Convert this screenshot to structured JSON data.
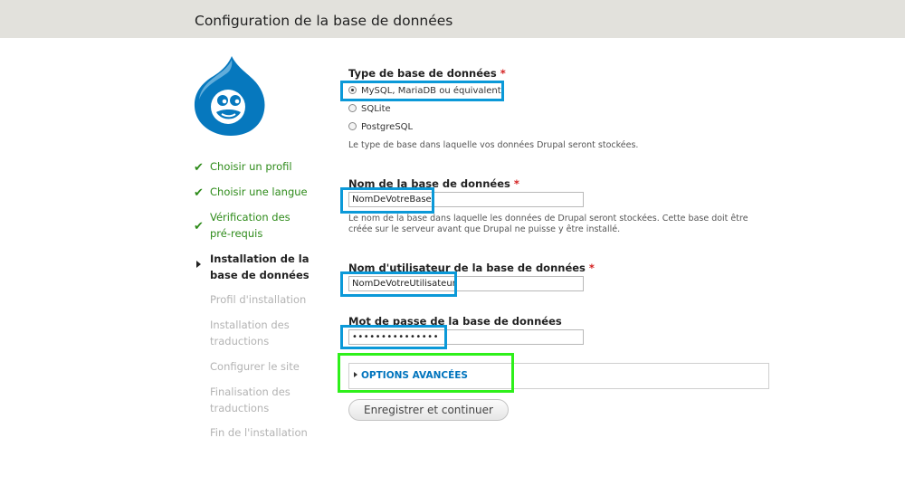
{
  "header": {
    "title": "Configuration de la base de données"
  },
  "steps": [
    {
      "label": "Choisir un profil",
      "state": "done"
    },
    {
      "label": "Choisir une langue",
      "state": "done"
    },
    {
      "label": "Vérification des pré-requis",
      "state": "done"
    },
    {
      "label": "Installation de la base de données",
      "state": "active"
    },
    {
      "label": "Profil d'installation",
      "state": "todo"
    },
    {
      "label": "Installation des traductions",
      "state": "todo"
    },
    {
      "label": "Configurer le site",
      "state": "todo"
    },
    {
      "label": "Finalisation des traductions",
      "state": "todo"
    },
    {
      "label": "Fin de l'installation",
      "state": "todo"
    }
  ],
  "form": {
    "db_type": {
      "label": "Type de base de données",
      "required_mark": "*",
      "options": [
        {
          "label": "MySQL, MariaDB ou équivalent",
          "selected": true
        },
        {
          "label": "SQLite",
          "selected": false
        },
        {
          "label": "PostgreSQL",
          "selected": false
        }
      ],
      "description": "Le type de base dans laquelle vos données Drupal seront stockées."
    },
    "db_name": {
      "label": "Nom de la base de données",
      "required_mark": "*",
      "value": "NomDeVotreBase",
      "description": "Le nom de la base dans laquelle les données de Drupal seront stockées. Cette base doit être créée sur le serveur avant que Drupal ne puisse y être installé."
    },
    "db_user": {
      "label": "Nom d'utilisateur de la base de données",
      "required_mark": "*",
      "value": "NomDeVotreUtilisateur"
    },
    "db_pass": {
      "label": "Mot de passe de la base de données",
      "value": "•••••••••••••••"
    },
    "advanced": {
      "label": "OPTIONS AVANCÉES"
    },
    "submit": {
      "label": "Enregistrer et continuer"
    }
  },
  "colors": {
    "header_bg": "#e2e1dc",
    "done": "#2e8b1a",
    "highlight_blue": "#0b99d8",
    "highlight_green": "#2ef01a",
    "link": "#0074bd",
    "drupal_blue": "#0678be"
  },
  "icons": [
    "drupal-logo",
    "check-icon",
    "arrow-right-icon",
    "radio-icon",
    "triangle-right-icon"
  ]
}
